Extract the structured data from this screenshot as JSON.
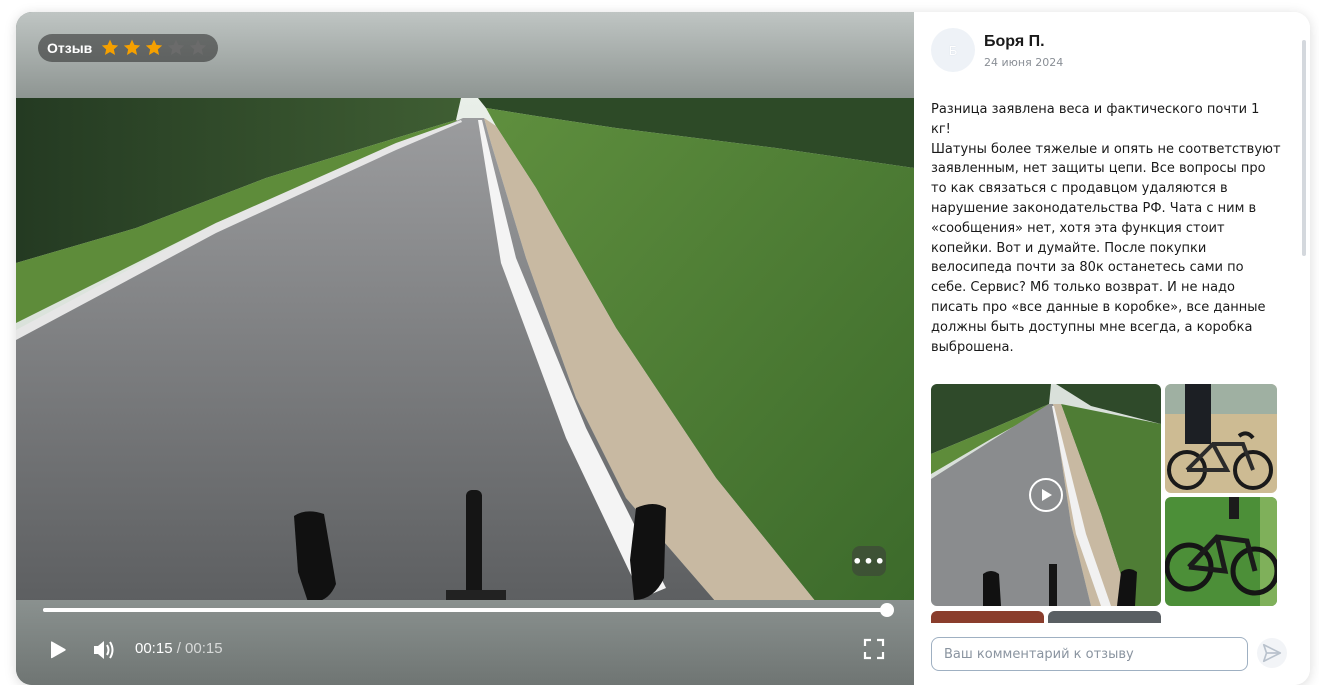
{
  "video": {
    "badge_label": "Отзыв",
    "rating": 3,
    "rating_max": 5,
    "current_time": "00:15",
    "total_time": " / 00:15",
    "progress": 1.0,
    "icons": {
      "star": "star-icon",
      "play": "play-icon",
      "volume": "volume-icon",
      "fullscreen": "fullscreen-icon",
      "more": "more-icon"
    },
    "more_label": "•••"
  },
  "review": {
    "avatar_initial": "Б",
    "author": "Боря П.",
    "date": "24 июня 2024",
    "text": "Разница заявлена веса и фактического почти 1 кг!\nШатуны более тяжелые и опять не соответствуют заявленным, нет защиты цепи. Все вопросы про то как связаться с продавцом удаляются в нарушение законодательства РФ. Чата с ним в «сообщения» нет, хотя эта функция стоит копейки. Вот и думайте. После покупки велосипеда почти за 80к останетесь сами по себе. Сервис? Мб только возврат. И не надо писать про «все данные в коробке», все данные должны быть доступны мне всегда, а коробка выброшена."
  },
  "comment": {
    "placeholder": "Ваш комментарий к отзыву",
    "send_icon": "send-icon"
  },
  "colors": {
    "star_active": "#f5a000",
    "star_inactive": "#6b6b6b",
    "input_border": "#9fb0c2"
  }
}
